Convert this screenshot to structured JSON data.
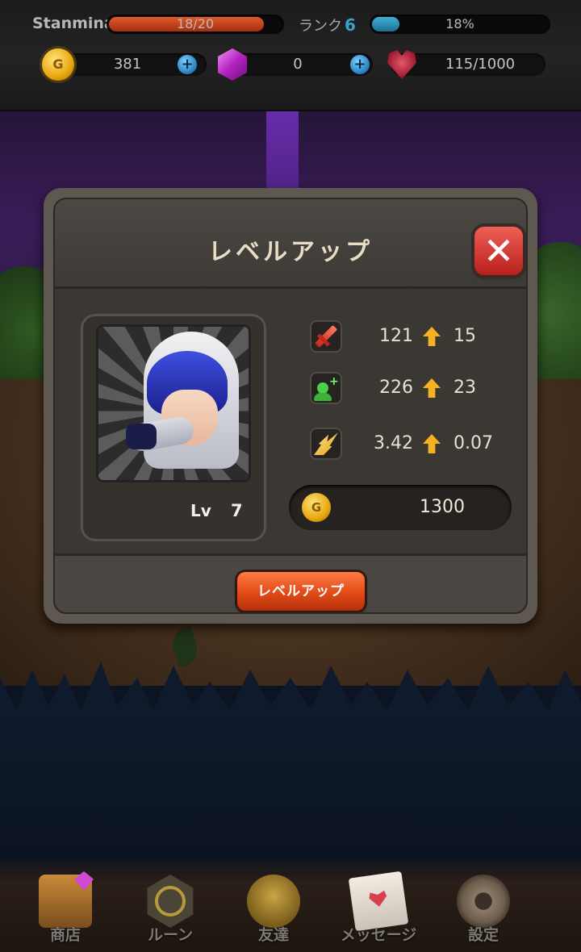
{
  "hud": {
    "player_name": "Stanmina",
    "stamina": {
      "text": "18/20",
      "fraction": 0.9
    },
    "rank": {
      "label": "ランク",
      "value": "6"
    },
    "exp": {
      "text": "18%",
      "fraction": 0.18
    },
    "gold": {
      "value": "381",
      "icon": "coin-icon",
      "coin_letter": "G"
    },
    "gems": {
      "value": "0",
      "icon": "gem-icon"
    },
    "hearts": {
      "value": "115/1000",
      "icon": "heart-icon"
    }
  },
  "dialog": {
    "title": "レベルアップ",
    "close_glyph": "✕",
    "character": {
      "level_label": "Lv",
      "level_value": "7"
    },
    "stats": [
      {
        "icon": "sword-icon",
        "base": "121",
        "increase": "15"
      },
      {
        "icon": "heal-icon",
        "base": "226",
        "increase": "23"
      },
      {
        "icon": "critical-icon",
        "base": "3.42",
        "increase": "0.07"
      }
    ],
    "cost": {
      "icon": "coin-icon",
      "coin_letter": "G",
      "value": "1300"
    },
    "level_up_button": "レベルアップ"
  },
  "nav": {
    "items": [
      {
        "label": "商店",
        "icon": "treasure-chest-icon"
      },
      {
        "label": "ルーン",
        "icon": "rune-icon"
      },
      {
        "label": "友達",
        "icon": "friend-helmet-icon"
      },
      {
        "label": "メッセージ",
        "icon": "letter-icon"
      },
      {
        "label": "設定",
        "icon": "gear-icon"
      }
    ]
  },
  "colors": {
    "stamina": "#e05a2a",
    "exp": "#3fb0d6",
    "accent_button": "#e14a16",
    "stat_arrow": "#f5b122"
  }
}
